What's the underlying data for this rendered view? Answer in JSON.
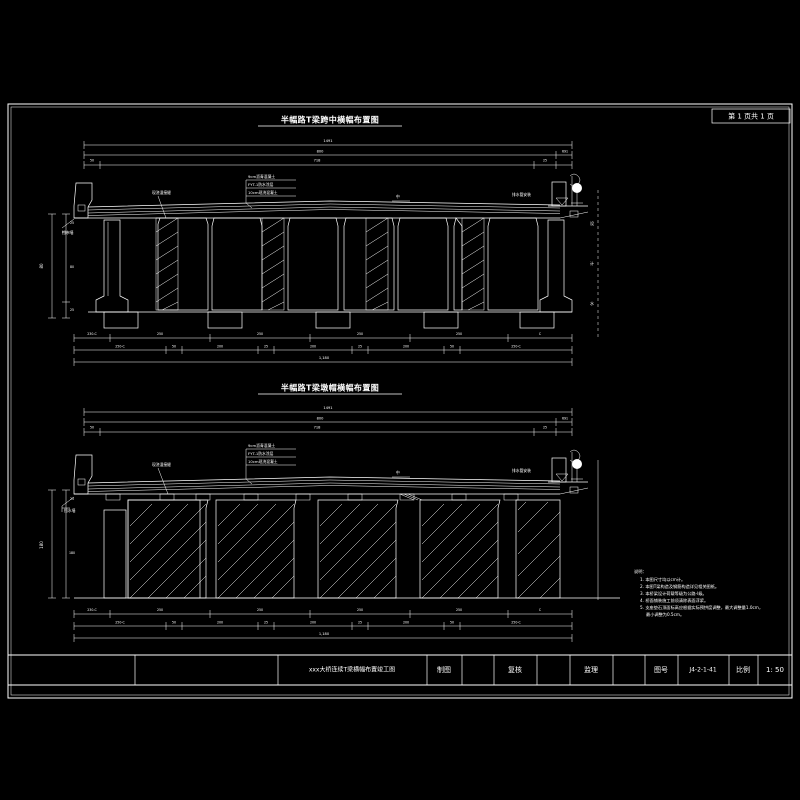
{
  "meta": {
    "background_color": "#000000",
    "line_color": "#ffffff",
    "drawing_type": "cad-engineering-drawing"
  },
  "page_badge": {
    "label": "第 1 页共 1 页"
  },
  "views": [
    {
      "id": "upper",
      "title": "半幅路T梁跨中横幅布置图",
      "top_dims": {
        "row1": [
          "1491"
        ],
        "row2": [
          "800",
          "691"
        ],
        "row3": [
          "50",
          "718",
          "25"
        ]
      },
      "bottom_dims": {
        "row1": [
          "230-C",
          "250",
          "250",
          "250",
          "250",
          "C"
        ],
        "row2": [
          "250-C",
          "50",
          "200",
          "25",
          "200",
          "25",
          "200",
          "50",
          "250-C"
        ],
        "row3": [
          "1,180"
        ]
      },
      "left_dims": [
        "25",
        "80",
        "25"
      ],
      "callouts": [
        "9cm沥青混凝土",
        "FYT-1防水涂层",
        "10cm现浇混凝土"
      ],
      "labels": {
        "deck": "现浇湿接缝",
        "abutment": "挡水墙",
        "right_pipe": "排水管安装",
        "center_mark": "中"
      },
      "right_levels": [
        "设",
        "计",
        "水"
      ]
    },
    {
      "id": "lower",
      "title": "半幅路T梁墩帽横幅布置图",
      "top_dims": {
        "row1": [
          "1491"
        ],
        "row2": [
          "800",
          "691"
        ],
        "row3": [
          "50",
          "718",
          "25"
        ]
      },
      "bottom_dims": {
        "row1": [
          "230-C",
          "250",
          "250",
          "250",
          "250",
          "C"
        ],
        "row2": [
          "250-C",
          "50",
          "200",
          "25",
          "200",
          "25",
          "200",
          "50",
          "250-C"
        ],
        "row3": [
          "1,180"
        ]
      },
      "left_dims": [
        "25",
        "180"
      ],
      "callouts": [
        "9cm沥青混凝土",
        "FYT-1防水涂层",
        "10cm现浇混凝土"
      ],
      "labels": {
        "deck": "现浇湿接缝",
        "abutment": "挡水墙",
        "right_pipe": "排水管安装",
        "center_mark": "中"
      }
    }
  ],
  "notes": {
    "heading": "说明：",
    "items": [
      "1. 本图尺寸均以cm计。",
      "2. 本图T梁构造及钢筋构造详见相关图纸。",
      "3. 本桥梁设计荷载等级为公路-I级。",
      "4. 桥面铺装施工前须清除表面浮浆。",
      "5. 支座垫石顶面标高应根据实际预拱度调整，最大调整量1.0cm，",
      "   最小调整为0.5cm。"
    ]
  },
  "title_block": {
    "project": "xxx大桥连续T梁横幅布置竣工图",
    "fields": [
      {
        "label": "制图",
        "value": ""
      },
      {
        "label": "复核",
        "value": ""
      },
      {
        "label": "监理",
        "value": ""
      }
    ],
    "drawing_no_label": "图号",
    "drawing_no_value": "J4-2-1-41",
    "scale_label": "比例",
    "scale_value": "1: 50"
  }
}
